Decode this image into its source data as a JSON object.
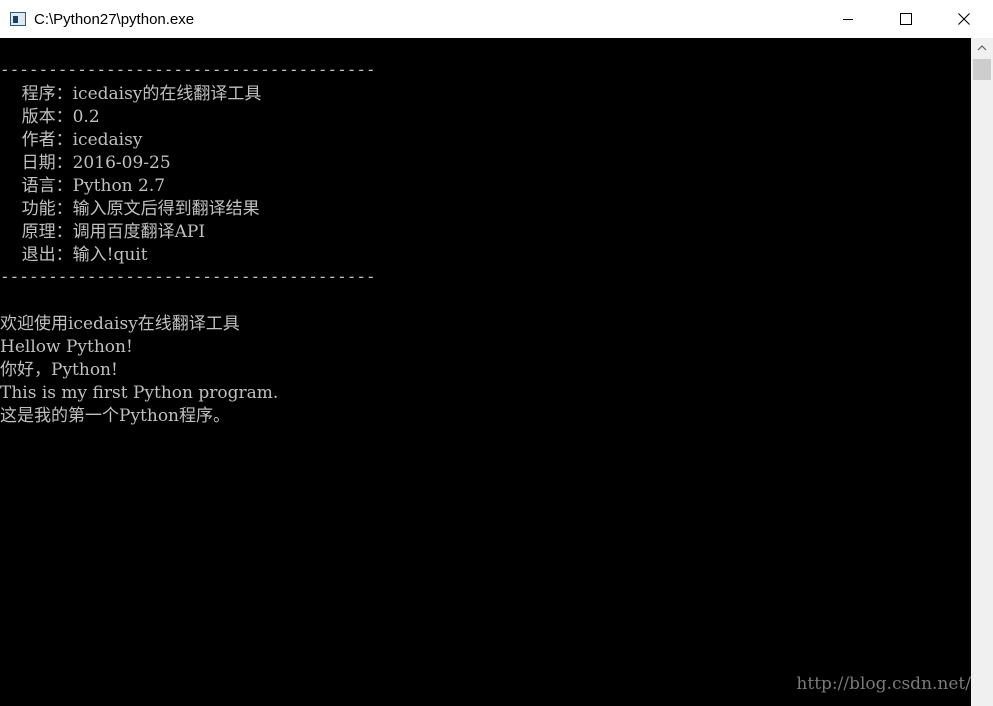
{
  "window": {
    "title": "C:\\Python27\\python.exe",
    "icon": "console-app-icon",
    "controls": {
      "minimize_icon": "minimize-icon",
      "maximize_icon": "maximize-icon",
      "close_icon": "close-icon"
    }
  },
  "console": {
    "separator_top": "---------------------------------------",
    "info": [
      "    程序：icedaisy的在线翻译工具",
      "    版本：0.2",
      "    作者：icedaisy",
      "    日期：2016-09-25",
      "    语言：Python 2.7",
      "    功能：输入原文后得到翻译结果",
      "    原理：调用百度翻译API",
      "    退出：输入!quit"
    ],
    "separator_bottom": "---------------------------------------",
    "output": [
      "欢迎使用icedaisy在线翻译工具",
      "Hellow Python!",
      "你好，Python!",
      "This is my first Python program.",
      "这是我的第一个Python程序。"
    ]
  },
  "watermark": "http://blog.csdn.net/",
  "colors": {
    "console_bg": "#000000",
    "console_text": "#c0c0c0",
    "titlebar_bg": "#ffffff",
    "scrollbar_bg": "#f0f0f0",
    "scroll_thumb": "#cdcdcd"
  }
}
